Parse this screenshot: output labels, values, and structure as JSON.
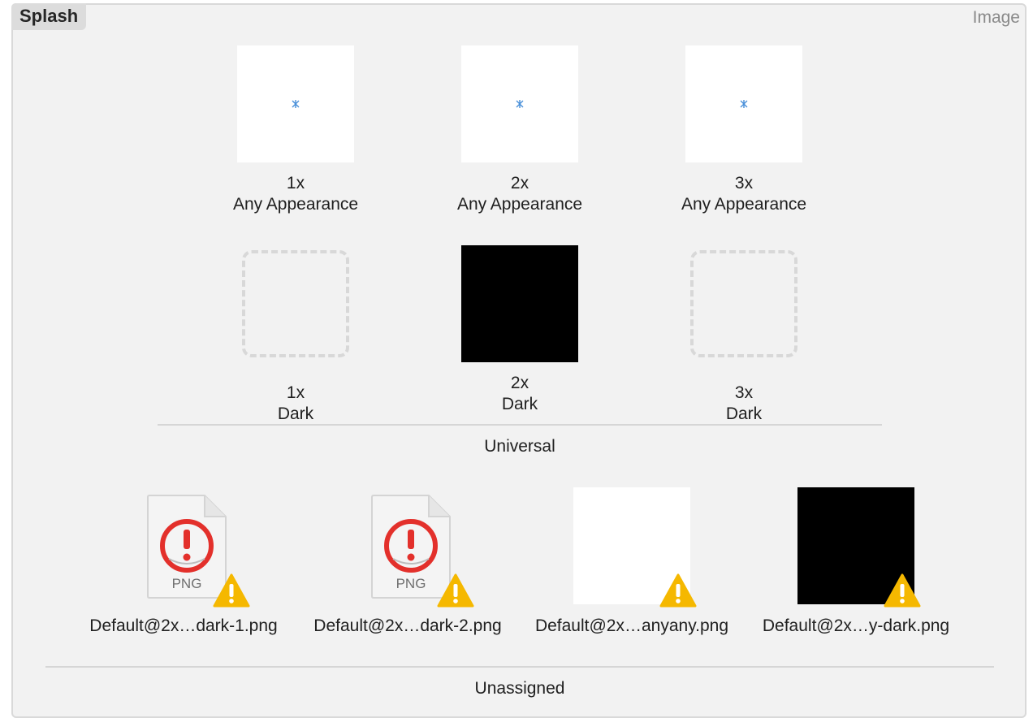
{
  "asset": {
    "name": "Splash",
    "type": "Image"
  },
  "universal": {
    "group_label": "Universal",
    "any_row": [
      {
        "scale": "1x",
        "appearance": "Any Appearance",
        "state": "white-image"
      },
      {
        "scale": "2x",
        "appearance": "Any Appearance",
        "state": "white-image"
      },
      {
        "scale": "3x",
        "appearance": "Any Appearance",
        "state": "white-image"
      }
    ],
    "dark_row": [
      {
        "scale": "1x",
        "appearance": "Dark",
        "state": "empty-slot"
      },
      {
        "scale": "2x",
        "appearance": "Dark",
        "state": "black-image"
      },
      {
        "scale": "3x",
        "appearance": "Dark",
        "state": "empty-slot"
      }
    ]
  },
  "unassigned": {
    "group_label": "Unassigned",
    "files": [
      {
        "label": "Default@2x…dark-1.png",
        "preview": "png-error-doc",
        "badge": "warning-icon",
        "doc_text": "PNG"
      },
      {
        "label": "Default@2x…dark-2.png",
        "preview": "png-error-doc",
        "badge": "warning-icon",
        "doc_text": "PNG"
      },
      {
        "label": "Default@2x…anyany.png",
        "preview": "white-image",
        "badge": "warning-icon"
      },
      {
        "label": "Default@2x…y-dark.png",
        "preview": "black-image",
        "badge": "warning-icon"
      }
    ]
  },
  "colors": {
    "panel_bg": "#f2f2f2",
    "warning": "#f5b800",
    "error": "#e3302b",
    "sparkle": "#4a90d9"
  }
}
